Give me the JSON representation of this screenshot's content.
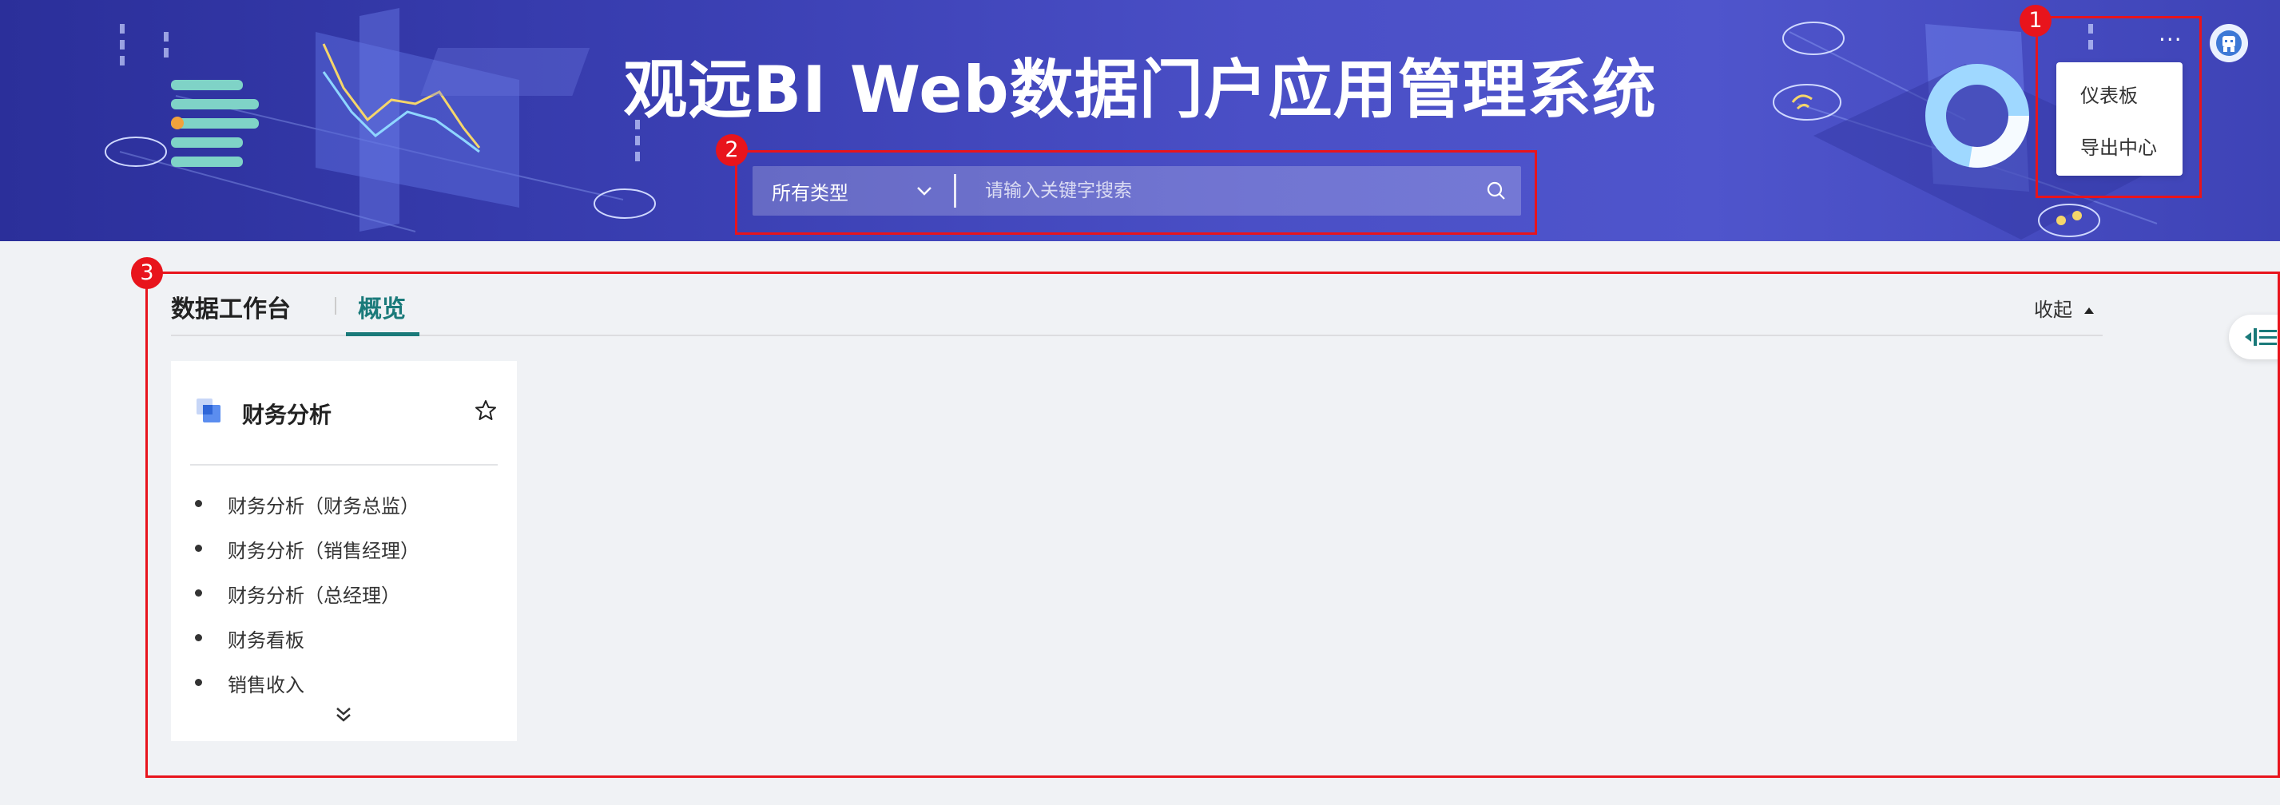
{
  "header": {
    "title": "观远BI Web数据门户应用管理系统",
    "more_icon": "more-dots-icon",
    "avatar_icon": "user-avatar-icon"
  },
  "search": {
    "type_label": "所有类型",
    "placeholder": "请输入关键字搜索"
  },
  "menu": {
    "items": [
      {
        "label": "仪表板"
      },
      {
        "label": "导出中心"
      }
    ]
  },
  "annotations": [
    {
      "label": "1"
    },
    {
      "label": "2"
    },
    {
      "label": "3"
    }
  ],
  "workspace": {
    "title": "数据工作台",
    "tabs": [
      {
        "label": "概览",
        "active": true
      }
    ],
    "collapse_label": "收起"
  },
  "card": {
    "title": "财务分析",
    "items": [
      {
        "label": "财务分析（财务总监）"
      },
      {
        "label": "财务分析（销售经理）"
      },
      {
        "label": "财务分析（总经理）"
      },
      {
        "label": "财务看板"
      },
      {
        "label": "销售收入"
      }
    ]
  },
  "colors": {
    "accent": "#1a7a7a",
    "annotation": "#e8141c",
    "banner": "#4a4fc6"
  }
}
